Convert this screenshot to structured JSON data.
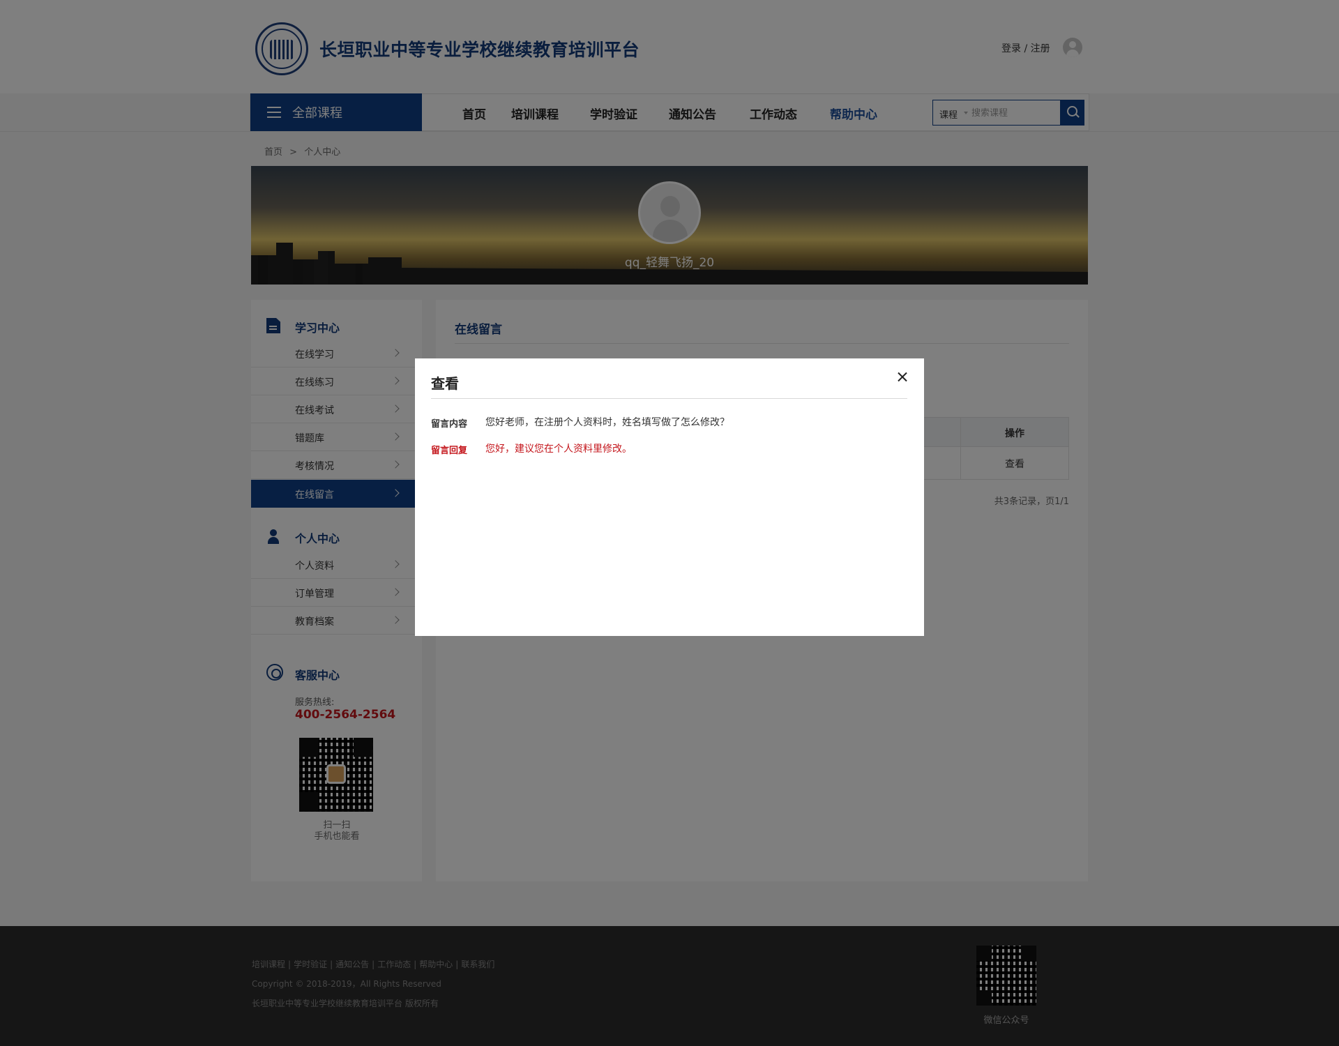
{
  "header": {
    "site_title": "长垣职业中等专业学校继续教育培训平台",
    "login_register": "登录 / 注册"
  },
  "nav": {
    "all_courses": "全部课程",
    "items": [
      "首页",
      "培训课程",
      "学时验证",
      "通知公告",
      "工作动态",
      "帮助中心"
    ],
    "active_index": 5
  },
  "search": {
    "category": "课程",
    "placeholder": "搜索课程"
  },
  "breadcrumb": [
    "首页",
    ">",
    "个人中心"
  ],
  "profile": {
    "username": "qq_轻舞飞扬_20"
  },
  "sidebar": {
    "study_title": "学习中心",
    "study_items": [
      "在线学习",
      "在线练习",
      "在线考试",
      "错题库",
      "考核情况",
      "在线留言"
    ],
    "active_item": "在线留言",
    "personal_title": "个人中心",
    "personal_items": [
      "个人资料",
      "订单管理",
      "教育档案"
    ],
    "service_title": "客服中心",
    "hotline_label": "服务热线:",
    "hotline": "400-2564-2564",
    "scan_line1": "扫一扫",
    "scan_line2": "手机也能看"
  },
  "content": {
    "title": "在线留言",
    "table_header_op": "操作",
    "row_action": "查看",
    "pager": "共3条记录，页1/1"
  },
  "footer": {
    "links": [
      "培训课程",
      "学时验证",
      "通知公告",
      "工作动态",
      "帮助中心",
      "联系我们"
    ],
    "copyright": "Copyright © 2018-2019，All Rights Reserved",
    "rights": "长垣职业中等专业学校继续教育培训平台 版权所有",
    "wechat_label": "微信公众号"
  },
  "modal": {
    "title": "查看",
    "message_label": "留言内容",
    "message_text": "您好老师，在注册个人资料时，姓名填写做了怎么修改？",
    "reply_label": "留言回复",
    "reply_text": "您好，建议您在个人资料里修改。"
  },
  "colors": {
    "brand_blue": "#0f3f86",
    "title_blue": "#123b7a",
    "accent_red": "#c4161c",
    "overlay": "rgba(0,0,0,0.5)"
  },
  "icons": [
    "menu-icon",
    "user-icon",
    "search-icon",
    "document-icon",
    "person-icon",
    "headset-icon",
    "chevron-right-icon",
    "close-icon",
    "qr-code"
  ]
}
